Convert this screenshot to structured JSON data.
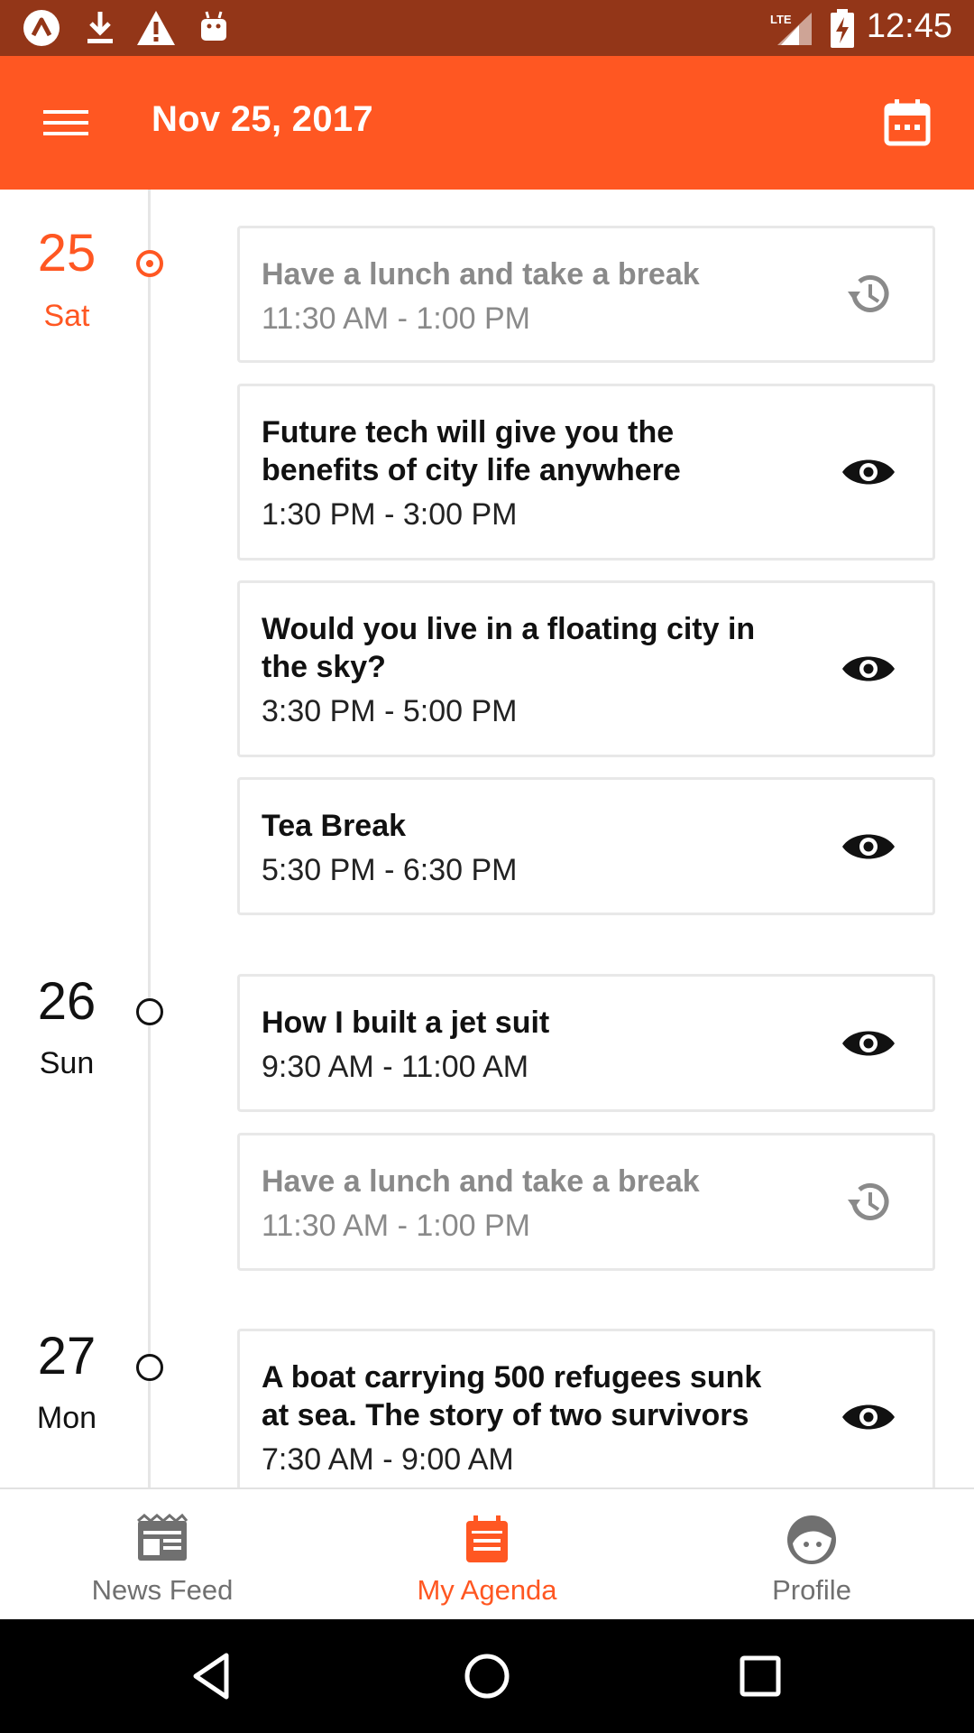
{
  "status_bar": {
    "time": "12:45",
    "network_label": "LTE",
    "icons": [
      "app-notification-icon",
      "download-icon",
      "warning-icon",
      "android-icon",
      "signal-icon",
      "battery-charging-icon"
    ]
  },
  "app_bar": {
    "title": "Nov 25, 2017",
    "menu_icon": "menu-icon",
    "calendar_icon": "calendar-icon"
  },
  "colors": {
    "accent": "#ff5722",
    "status_bar": "#933618",
    "past_text": "#8a8a8a"
  },
  "days": [
    {
      "number": "25",
      "name": "Sat",
      "active": true,
      "events": [
        {
          "title": "Have a lunch and take a break",
          "time": "11:30 AM - 1:00 PM",
          "state": "past",
          "icon": "history-icon"
        },
        {
          "title": "Future tech will give you the benefits of city life anywhere",
          "time": "1:30 PM - 3:00 PM",
          "state": "upcoming",
          "icon": "eye-icon"
        },
        {
          "title": "Would you live in a floating city in the sky?",
          "time": "3:30 PM - 5:00 PM",
          "state": "upcoming",
          "icon": "eye-icon"
        },
        {
          "title": "Tea Break",
          "time": "5:30 PM - 6:30 PM",
          "state": "upcoming",
          "icon": "eye-icon"
        }
      ]
    },
    {
      "number": "26",
      "name": "Sun",
      "active": false,
      "events": [
        {
          "title": "How I built a jet suit",
          "time": "9:30 AM - 11:00 AM",
          "state": "upcoming",
          "icon": "eye-icon"
        },
        {
          "title": "Have a lunch and take a break",
          "time": "11:30 AM - 1:00 PM",
          "state": "past",
          "icon": "history-icon"
        }
      ]
    },
    {
      "number": "27",
      "name": "Mon",
      "active": false,
      "events": [
        {
          "title": "A boat carrying 500 refugees sunk at sea. The story of two survivors",
          "time": "7:30 AM - 9:00 AM",
          "state": "upcoming",
          "icon": "eye-icon"
        }
      ]
    }
  ],
  "bottom_nav": [
    {
      "label": "News Feed",
      "icon": "news-feed-icon",
      "active": false
    },
    {
      "label": "My Agenda",
      "icon": "agenda-icon",
      "active": true
    },
    {
      "label": "Profile",
      "icon": "profile-icon",
      "active": false
    }
  ],
  "system_nav": [
    "back-icon",
    "home-icon",
    "recents-icon"
  ]
}
